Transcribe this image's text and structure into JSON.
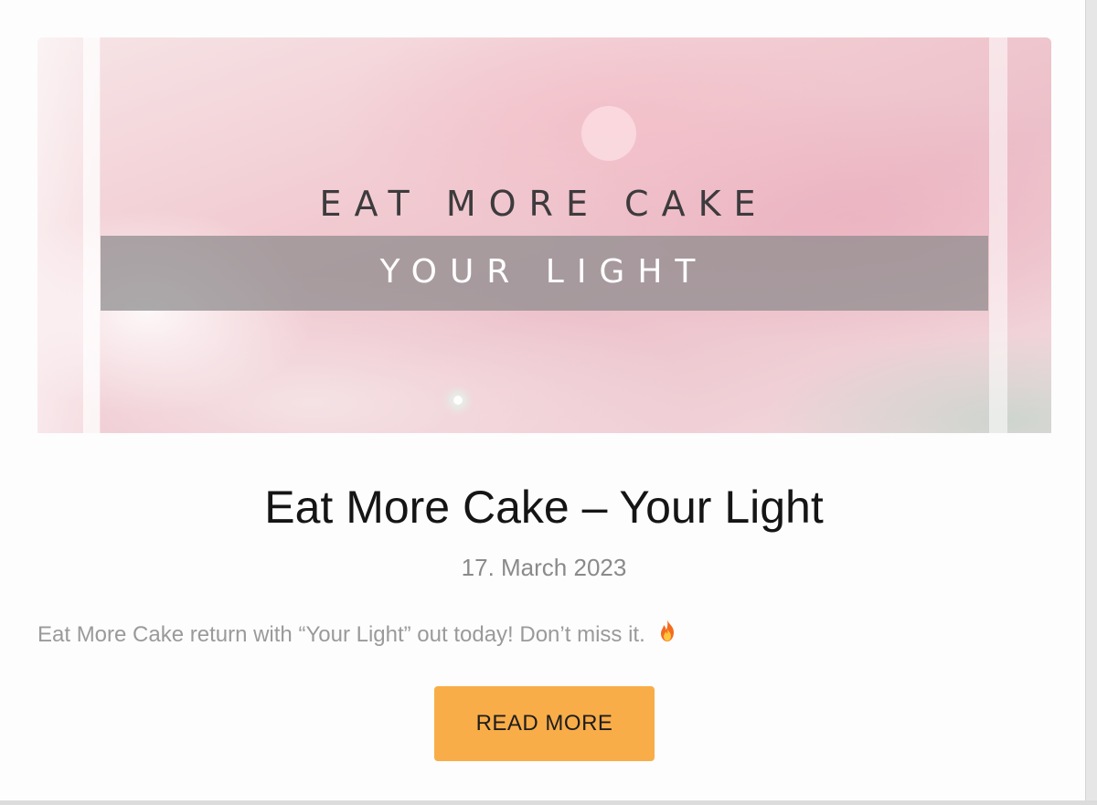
{
  "post": {
    "hero_image": {
      "line1": "EAT MORE CAKE",
      "line2": "YOUR LIGHT"
    },
    "title": "Eat More Cake – Your Light",
    "date": "17. March 2023",
    "excerpt": "Eat More Cake return with “Your Light” out today! Don’t miss it.",
    "excerpt_icon": "fire-icon",
    "read_more_label": "READ MORE"
  },
  "colors": {
    "button": "#f9ad48",
    "title": "#151515",
    "meta_text": "#8a8a8a",
    "excerpt_text": "#9a9a9a"
  }
}
